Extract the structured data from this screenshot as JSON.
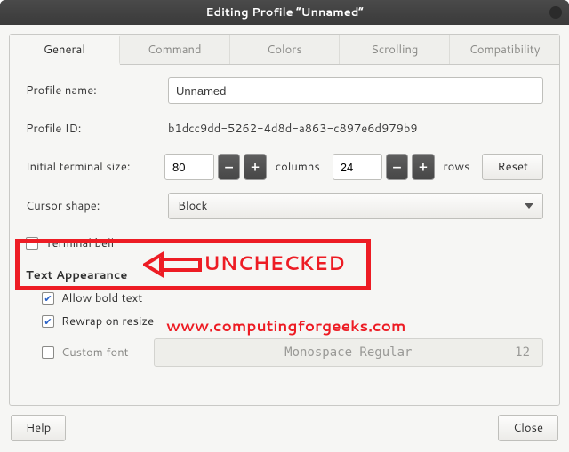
{
  "window": {
    "title": "Editing Profile “Unnamed”"
  },
  "tabs": {
    "general": "General",
    "command": "Command",
    "colors": "Colors",
    "scrolling": "Scrolling",
    "compatibility": "Compatibility"
  },
  "general": {
    "profile_name_label": "Profile name:",
    "profile_name_value": "Unnamed",
    "profile_id_label": "Profile ID:",
    "profile_id_value": "b1dcc9dd-5262-4d8d-a863-c897e6d979b9",
    "initial_size_label": "Initial terminal size:",
    "cols_value": "80",
    "cols_unit": "columns",
    "rows_value": "24",
    "rows_unit": "rows",
    "reset_label": "Reset",
    "cursor_shape_label": "Cursor shape:",
    "cursor_shape_value": "Block",
    "terminal_bell_label": "Terminal bell",
    "text_appearance_title": "Text Appearance",
    "allow_bold_label": "Allow bold text",
    "rewrap_label": "Rewrap on resize",
    "custom_font_label": "Custom font",
    "font_name": "Monospace Regular",
    "font_size": "12"
  },
  "footer": {
    "help": "Help",
    "close": "Close"
  },
  "annotation": {
    "unchecked": "UNCHECKED",
    "watermark": "www.computingforgeeks.com"
  }
}
